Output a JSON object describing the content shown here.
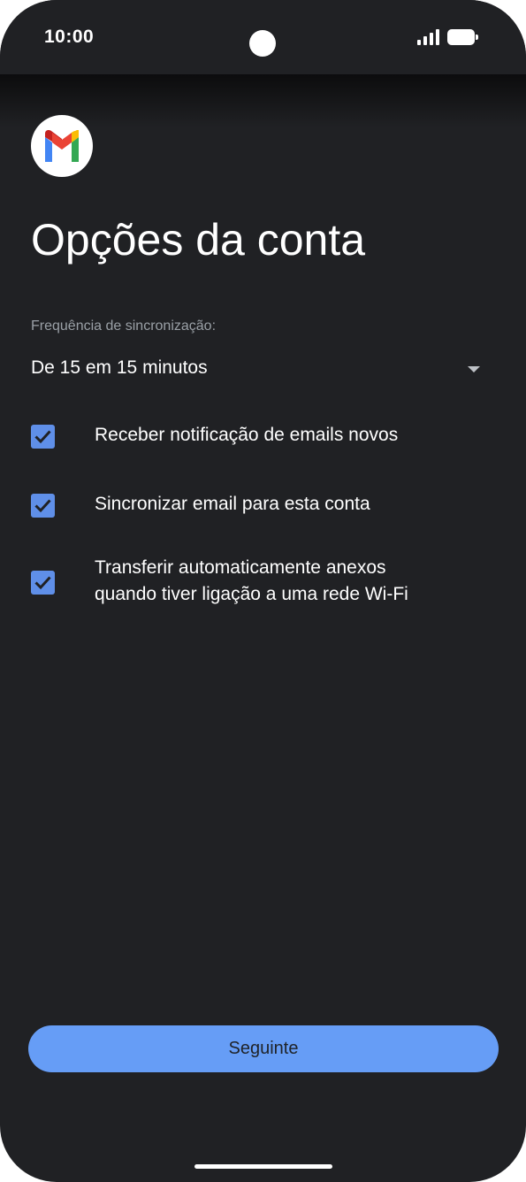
{
  "status_bar": {
    "time": "10:00",
    "signal_icon": "cellular-signal-icon",
    "battery_icon": "battery-full-icon"
  },
  "app": {
    "logo_icon": "gmail-logo-icon"
  },
  "page": {
    "title": "Opções da conta"
  },
  "sync": {
    "label": "Frequência de sincronização:",
    "selected_value": "De 15 em 15 minutos",
    "dropdown_icon": "dropdown-arrow-icon"
  },
  "options": [
    {
      "line1": "Receber notificação de emails novos",
      "line2": "",
      "checked": true
    },
    {
      "line1": "Sincronizar email para esta conta",
      "line2": "",
      "checked": true
    },
    {
      "line1": "Transferir automaticamente anexos",
      "line2": "quando tiver ligação a uma rede Wi-Fi",
      "checked": true
    }
  ],
  "actions": {
    "next_label": "Seguinte"
  },
  "colors": {
    "background": "#202124",
    "accent": "#669df6",
    "checkbox": "#5f8fe8",
    "text_primary": "#ffffff",
    "text_secondary": "#9aa0a6"
  }
}
